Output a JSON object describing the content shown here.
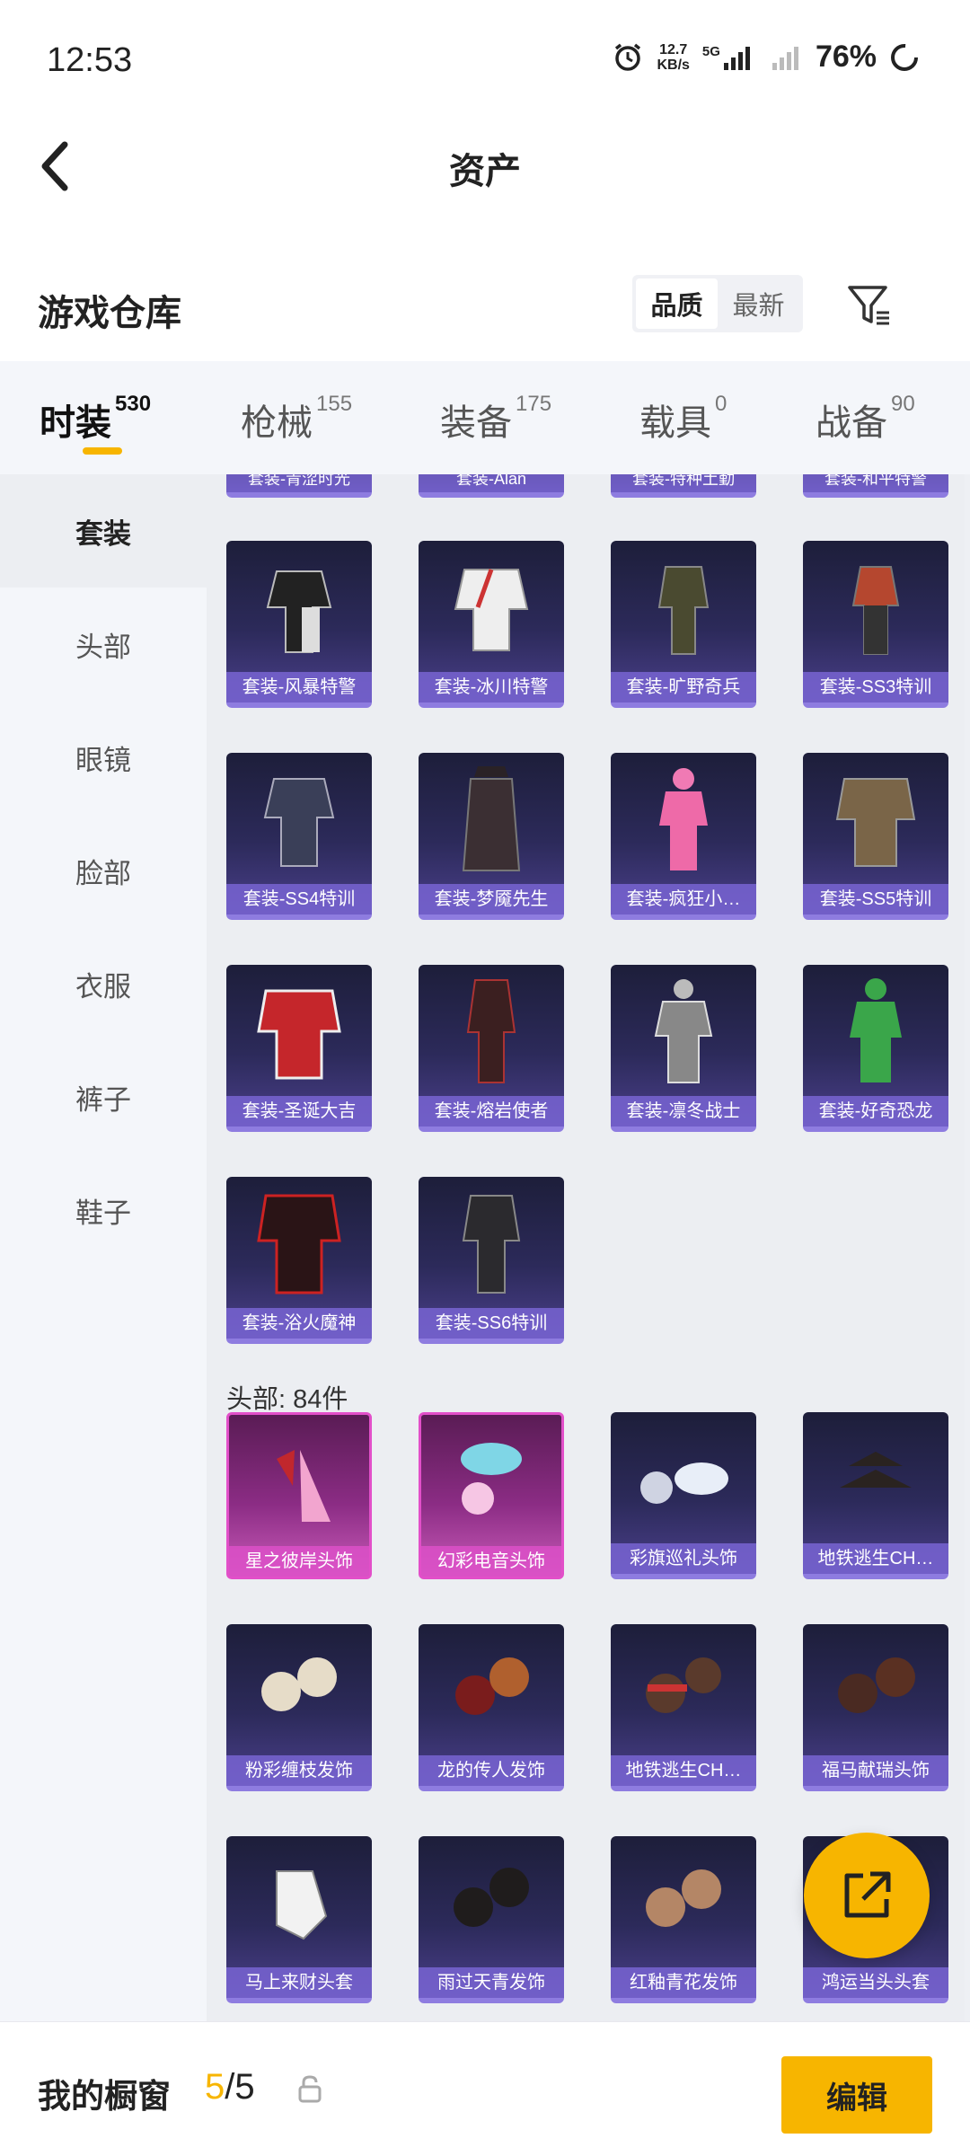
{
  "status": {
    "time": "12:53",
    "speed_top": "12.7",
    "speed_bottom": "KB/s",
    "network": "5G",
    "battery": "76%"
  },
  "nav": {
    "title": "资产"
  },
  "warehouse": {
    "title": "游戏仓库",
    "sort_options": [
      "品质",
      "最新"
    ],
    "sort_active": "品质"
  },
  "categories": [
    {
      "label": "时装",
      "count": "530"
    },
    {
      "label": "枪械",
      "count": "155"
    },
    {
      "label": "装备",
      "count": "175"
    },
    {
      "label": "载具",
      "count": "0"
    },
    {
      "label": "战备",
      "count": "90"
    }
  ],
  "sidebar": [
    "套装",
    "头部",
    "眼镜",
    "脸部",
    "衣服",
    "裤子",
    "鞋子"
  ],
  "partial_row": [
    "套装-青涩时光",
    "套装-Alan",
    "套装-特种土勤",
    "套装-和平特警"
  ],
  "suits": [
    "套装-风暴特警",
    "套装-冰川特警",
    "套装-旷野奇兵",
    "套装-SS3特训",
    "套装-SS4特训",
    "套装-梦魇先生",
    "套装-疯狂小…",
    "套装-SS5特训",
    "套装-圣诞大吉",
    "套装-熔岩使者",
    "套装-凛冬战士",
    "套装-好奇恐龙",
    "套装-浴火魔神",
    "套装-SS6特训"
  ],
  "head_section_label": "头部: 84件",
  "heads": [
    "星之彼岸头饰",
    "幻彩电音头饰",
    "彩旗巡礼头饰",
    "地铁逃生CH…",
    "粉彩缠枝发饰",
    "龙的传人发饰",
    "地铁逃生CH…",
    "福马献瑞头饰",
    "马上来财头套",
    "雨过天青发饰",
    "红釉青花发饰",
    "鸿运当头头套"
  ],
  "showcase": {
    "title": "我的橱窗",
    "current": "5",
    "total": "/5",
    "edit_label": "编辑"
  },
  "colors": {
    "accent": "#f7b500",
    "card_purple": "#2c2a5a",
    "card_pink": "#8b2c84"
  }
}
